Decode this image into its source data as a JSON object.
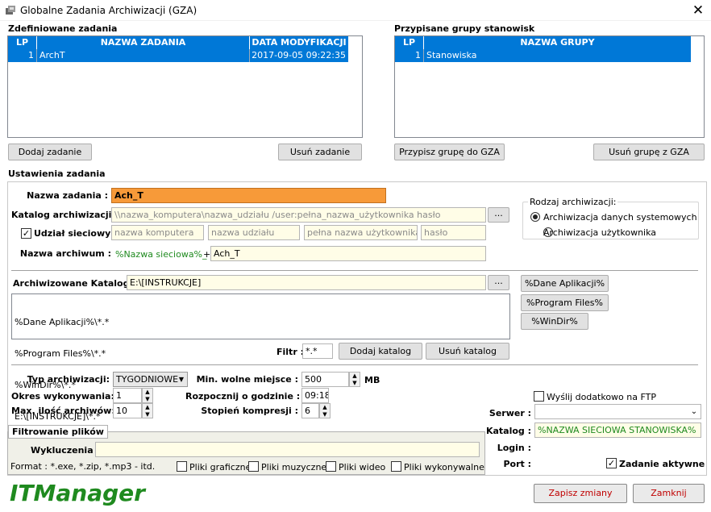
{
  "window": {
    "title": "Globalne Zadania Archiwizacji (GZA)",
    "close": "✕"
  },
  "tasks": {
    "label": "Zdefiniowane zadania",
    "columns": [
      "LP",
      "NAZWA ZADANIA",
      "DATA MODYFIKACJI"
    ],
    "rows": [
      {
        "lp": "1",
        "name": "ArchT",
        "date": "2017-09-05 09:22:35"
      }
    ],
    "add_button": "Dodaj zadanie",
    "remove_button": "Usuń zadanie"
  },
  "groups": {
    "label": "Przypisane grupy stanowisk",
    "columns": [
      "LP",
      "NAZWA GRUPY"
    ],
    "rows": [
      {
        "lp": "1",
        "name": "Stanowiska"
      }
    ],
    "assign_button": "Przypisz grupę do GZA",
    "remove_button": "Usuń grupę z GZA"
  },
  "settings": {
    "label": "Ustawienia zadania",
    "task_name_label": "Nazwa zadania :",
    "task_name_value": "Ach_T",
    "catalog_label": "Katalog archiwizacji :",
    "catalog_value": "\\\\nazwa_komputera\\nazwa_udziału /user:pełna_nazwa_użytkownika hasło",
    "browse": "...",
    "network_share_label": "Udział sieciowy :",
    "network_share_checked": "✓",
    "share_fields": [
      "nazwa komputera",
      "nazwa udziału",
      "pełna nazwa użytkownika",
      "hasło"
    ],
    "archive_name_label": "Nazwa archiwum :",
    "archive_name_prefix": "%Nazwa sieciowa%_",
    "plus": "+",
    "archive_name_value": "Ach_T",
    "archive_type_group": {
      "label": "Rodzaj archiwizacji:",
      "options": [
        {
          "label": "Archiwizacja danych systemowych",
          "selected": true
        },
        {
          "label": "Archiwizacja użytkownika",
          "selected": false
        }
      ]
    },
    "archived_catalogs_label": "Archiwizowane Katalogi :",
    "archived_catalogs_value": "E:\\[INSTRUKCJE]",
    "catalog_list": [
      "%Dane Aplikacji%\\*.*",
      "%Program Files%\\*.*",
      "%WinDir%\\*.*",
      "E:\\[INSTRUKCJE]\\*.*"
    ],
    "macro_buttons": [
      "%Dane Aplikacji%",
      "%Program Files%",
      "%WinDir%"
    ],
    "filter_label": "Filtr :",
    "filter_value": "*.*",
    "add_catalog": "Dodaj katalog",
    "remove_catalog": "Usuń katalog",
    "archive_type_label": "Typ archiwizacji:",
    "archive_type_value": "TYGODNIOWE",
    "period_label": "Okres wykonywania:",
    "period_value": "1",
    "max_archives_label": "Max. ilość archiwów:",
    "max_archives_value": "10",
    "min_space_label": "Min. wolne miejsce :",
    "min_space_value": "500",
    "min_space_unit": "MB",
    "start_hour_label": "Rozpocznij o godzinie :",
    "start_hour_value": "09:18",
    "compression_label": "Stopień kompresji :",
    "compression_value": "6"
  },
  "filtering": {
    "label": "Filtrowanie plików",
    "exclusions_label": "Wykluczenia :",
    "exclusions_value": "",
    "format_hint": "Format : *.exe, *.zip, *.mp3 - itd.",
    "checkboxes": [
      "Pliki graficzne",
      "Pliki muzyczne",
      "Pliki wideo",
      "Pliki wykonywalne"
    ]
  },
  "ftp": {
    "send_label": "Wyślij dodatkowo na FTP",
    "server_label": "Serwer :",
    "server_value": "",
    "catalog_label": "Katalog :",
    "catalog_value": "%NAZWA SIECIOWA STANOWISKA%",
    "login_label": "Login :",
    "port_label": "Port :",
    "active_label": "Zadanie aktywne",
    "active_checked": "✓"
  },
  "footer": {
    "logo": "ITManager",
    "save_button": "Zapisz zmiany",
    "close_button": "Zamknij"
  },
  "colors": {
    "selection": "#0078d7",
    "accent_orange": "#f79a39",
    "logo_green": "#1f8a1f",
    "input_bg": "#fffde7"
  }
}
